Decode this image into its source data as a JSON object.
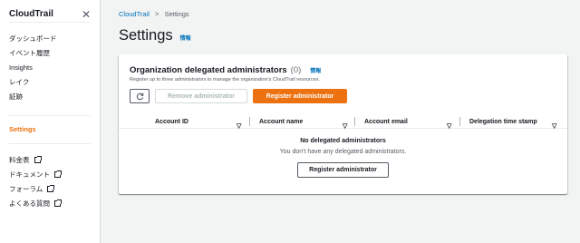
{
  "sidebar": {
    "title": "CloudTrail",
    "close_icon": "close-icon",
    "nav_items": [
      {
        "label": "ダッシュボード"
      },
      {
        "label": "イベント履歴"
      },
      {
        "label": "Insights"
      },
      {
        "label": "レイク"
      },
      {
        "label": "証跡"
      }
    ],
    "active_item": "Settings",
    "external_links": [
      {
        "label": "料金表",
        "icon": "external-link-icon"
      },
      {
        "label": "ドキュメント",
        "icon": "external-link-icon"
      },
      {
        "label": "フォーラム",
        "icon": "external-link-icon"
      },
      {
        "label": "よくある質問",
        "icon": "external-link-icon"
      }
    ]
  },
  "breadcrumb": {
    "link": "CloudTrail",
    "separator": ">",
    "current": "Settings"
  },
  "page": {
    "title": "Settings",
    "info": "情報"
  },
  "card": {
    "title": "Organization delegated administrators",
    "count": "(0)",
    "info": "情報",
    "description": "Register up to three administrators to manage the organization's CloudTrail resources.",
    "refresh_icon": "refresh-icon",
    "remove_button": "Remove administrator",
    "register_button": "Register administrator",
    "columns": [
      "Account ID",
      "Account name",
      "Account email",
      "Delegation time stamp"
    ],
    "empty_title": "No delegated administrators",
    "empty_description": "You don't have any delegated administrators.",
    "empty_button": "Register administrator"
  },
  "colors": {
    "accent": "#ec7211",
    "link": "#0073bb",
    "background": "#f2f3f3"
  }
}
